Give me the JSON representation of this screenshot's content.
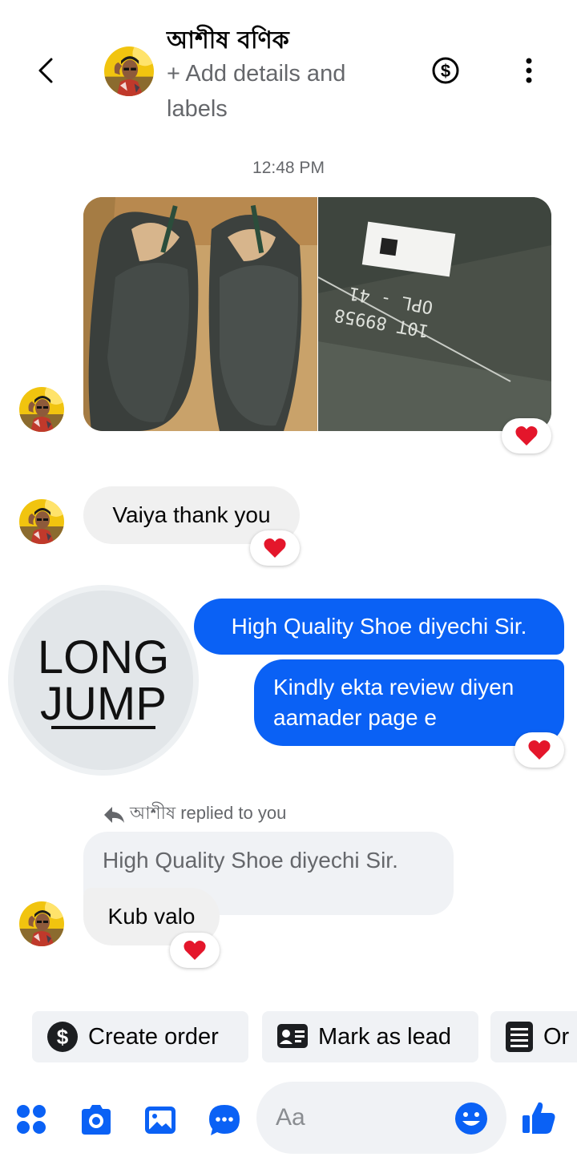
{
  "header": {
    "contact_name": "আশীষ বণিক",
    "subtitle": "+ Add details and labels",
    "back_icon": "chevron-left-icon",
    "payment_icon": "dollar-circle-icon",
    "more_icon": "more-vertical-icon"
  },
  "timestamp": "12:48 PM",
  "messages": {
    "incoming_thanks": "Vaiya thank you",
    "outgoing_1": "High Quality Shoe diyechi Sir.",
    "outgoing_2": "Kindly ekta review diyen aamader page e",
    "reply_note": "আশীষ replied to you",
    "quoted": "High Quality Shoe diyechi Sir.",
    "reply_text": "Kub valo"
  },
  "brand_logo": {
    "line1": "LONG",
    "line2": "JUMP"
  },
  "photo_box_text": {
    "line1": "10T 89958",
    "line2": "OPL - 41"
  },
  "reactions": {
    "emoji": "heart"
  },
  "chips": {
    "create_order": "Create order",
    "mark_as_lead": "Mark as lead",
    "third": "Or"
  },
  "composer": {
    "placeholder": "Aa",
    "icons": [
      "apps-icon",
      "camera-icon",
      "image-icon",
      "chat-bubble-icon",
      "emoji-icon",
      "thumbs-up-icon"
    ]
  },
  "colors": {
    "accent": "#0a61f5",
    "bubble_incoming": "#f0f0f0",
    "heart": "#e4162b"
  }
}
